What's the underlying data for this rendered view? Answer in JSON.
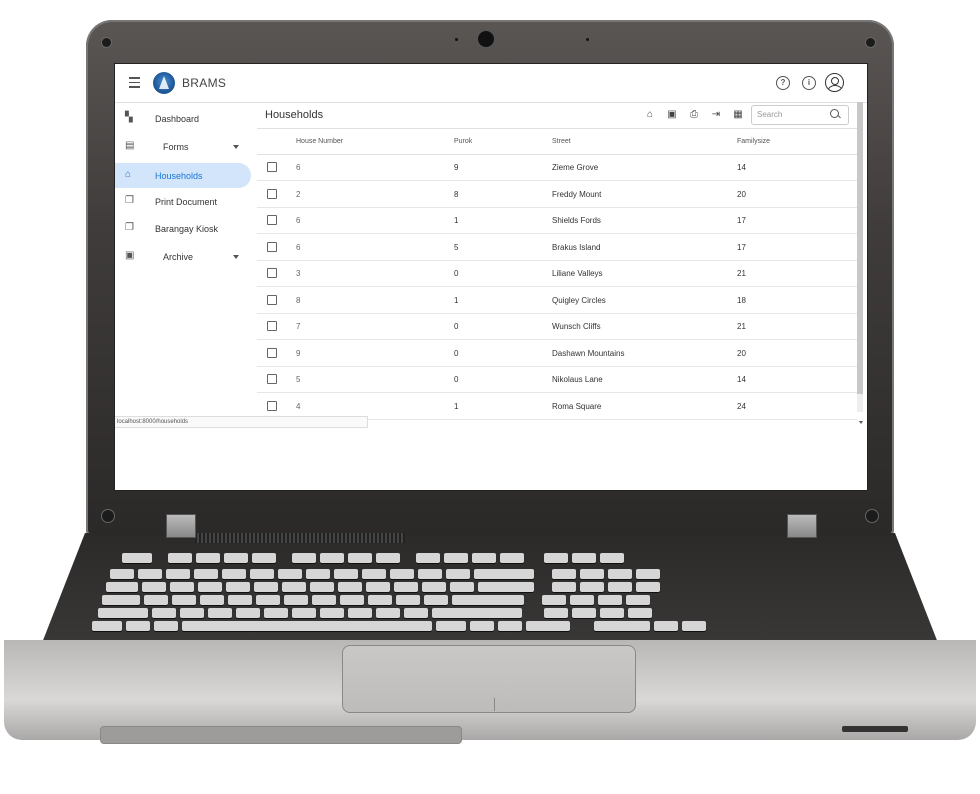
{
  "app": {
    "title": "BRAMS"
  },
  "topbar": {
    "help_icon": "?",
    "info_icon": "i"
  },
  "sidebar": {
    "items": [
      {
        "label": "Dashboard",
        "icon": "dashboard-icon",
        "glyph": "▚"
      },
      {
        "label": "Forms",
        "icon": "form-icon",
        "glyph": "▤",
        "has_caret": true
      },
      {
        "label": "Households",
        "icon": "home-icon",
        "glyph": "⌂",
        "active": true
      },
      {
        "label": "Print Document",
        "icon": "copy-icon",
        "glyph": "❐"
      },
      {
        "label": "Barangay Kiosk",
        "icon": "copy-icon",
        "glyph": "❐"
      },
      {
        "label": "Archive",
        "icon": "archive-icon",
        "glyph": "▣",
        "has_caret": true
      }
    ]
  },
  "page": {
    "title": "Households",
    "search_placeholder": "Search",
    "actions": [
      {
        "icon": "home-icon",
        "glyph": "⌂"
      },
      {
        "icon": "folder-icon",
        "glyph": "▣"
      },
      {
        "icon": "print-icon",
        "glyph": "⎙"
      },
      {
        "icon": "export-icon",
        "glyph": "⇥"
      },
      {
        "icon": "columns-icon",
        "glyph": "▦"
      }
    ]
  },
  "table": {
    "columns": [
      "House Number",
      "Purok",
      "Street",
      "Familysize"
    ],
    "rows": [
      [
        "6",
        "9",
        "Zieme Grove",
        "14"
      ],
      [
        "2",
        "8",
        "Freddy Mount",
        "20"
      ],
      [
        "6",
        "1",
        "Shields Fords",
        "17"
      ],
      [
        "6",
        "5",
        "Brakus Island",
        "17"
      ],
      [
        "3",
        "0",
        "Liliane Valleys",
        "21"
      ],
      [
        "8",
        "1",
        "Quigley Circles",
        "18"
      ],
      [
        "7",
        "0",
        "Wunsch Cliffs",
        "21"
      ],
      [
        "9",
        "0",
        "Dashawn Mountains",
        "20"
      ],
      [
        "5",
        "0",
        "Nikolaus Lane",
        "14"
      ],
      [
        "4",
        "1",
        "Roma Square",
        "24"
      ]
    ]
  },
  "status": {
    "url": "localhost:8000/households"
  },
  "colors": {
    "accent": "#1976d2",
    "active_bg": "#d3e5fb"
  }
}
